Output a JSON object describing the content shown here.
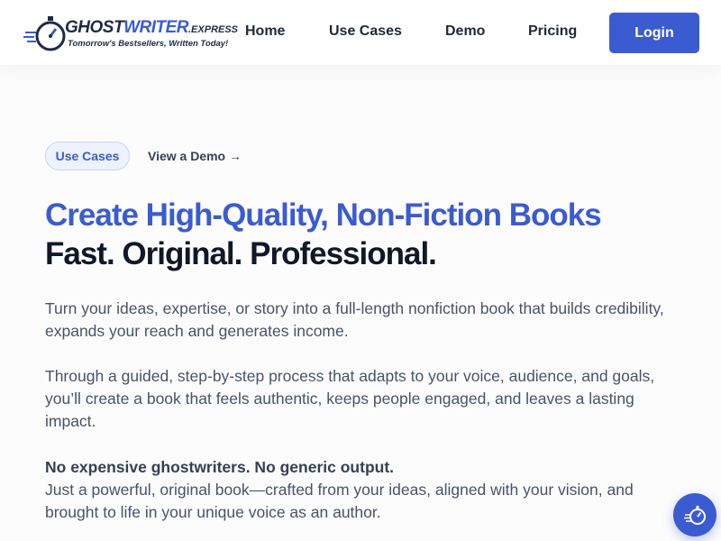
{
  "brand": {
    "name_part1": "GHOST",
    "name_part2": "WRITER",
    "name_suffix": ".EXPRESS",
    "tagline": "Tomorrow's Bestsellers, Written Today!",
    "logo_icon": "stopwatch-icon",
    "colors": {
      "primary": "#3b5bd1",
      "dark": "#101828"
    }
  },
  "nav": {
    "items": [
      {
        "label": "Home"
      },
      {
        "label": "Use Cases"
      },
      {
        "label": "Demo"
      },
      {
        "label": "Pricing"
      }
    ],
    "login_label": "Login"
  },
  "hero": {
    "pill_label": "Use Cases",
    "demo_link": "View a Demo →",
    "title_line1": "Create High-Quality, Non-Fiction Books",
    "title_line2": "Fast. Original. Professional.",
    "paragraph1": "Turn your ideas, expertise, or story into a full-length nonfiction book that builds credibility, expands your reach and generates income.",
    "paragraph2": "Through a guided, step-by-step process that adapts to your voice, audience, and goals, you’ll create a book that feels authentic, keeps people engaged, and leaves a lasting impact.",
    "paragraph3_bold": "No expensive ghostwriters. No generic output.",
    "paragraph3": "Just a powerful, original book—crafted from your ideas, aligned with your vision, and brought to life in your unique voice as an author."
  },
  "floating_button": {
    "icon": "stopwatch-icon"
  }
}
